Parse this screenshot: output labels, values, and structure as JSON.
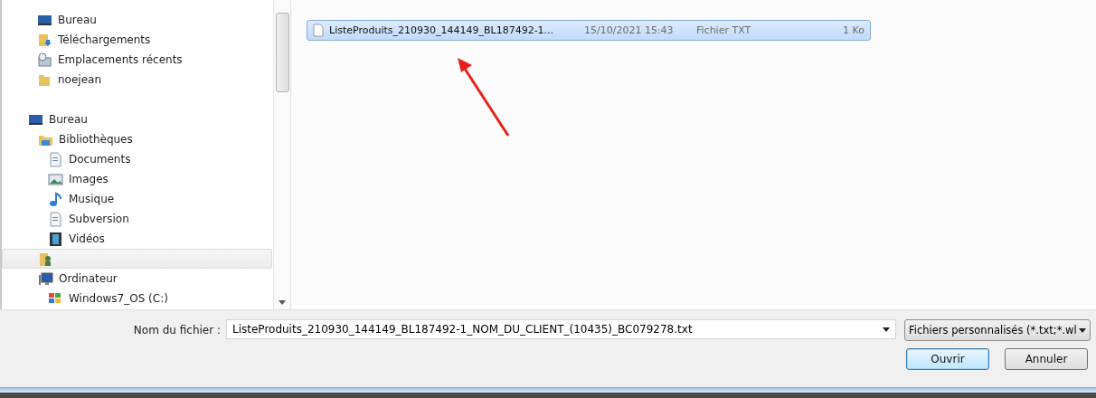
{
  "nav": {
    "favorites": [
      {
        "kind": "desktop",
        "label": "Bureau",
        "selected": false
      },
      {
        "kind": "download",
        "label": "Téléchargements",
        "selected": false
      },
      {
        "kind": "recent",
        "label": "Emplacements récents",
        "selected": false
      },
      {
        "kind": "folder",
        "label": "noejean",
        "selected": false
      }
    ],
    "tree": [
      {
        "kind": "desktop",
        "label": "Bureau",
        "selected": false,
        "children": [
          {
            "kind": "library",
            "label": "Bibliothèques",
            "selected": false,
            "children": [
              {
                "kind": "document",
                "label": "Documents",
                "selected": false
              },
              {
                "kind": "images",
                "label": "Images",
                "selected": false
              },
              {
                "kind": "music",
                "label": "Musique",
                "selected": false
              },
              {
                "kind": "document",
                "label": "Subversion",
                "selected": false
              },
              {
                "kind": "video",
                "label": "Vidéos",
                "selected": false
              }
            ]
          },
          {
            "kind": "user",
            "selected": true
          },
          {
            "kind": "computer",
            "label": "Ordinateur",
            "selected": false,
            "children": [
              {
                "kind": "drive",
                "label": "Windows7_OS (C:)",
                "selected": false
              }
            ]
          }
        ]
      }
    ]
  },
  "files": [
    {
      "name": "ListeProduits_210930_144149_BL187492-1...",
      "date": "15/10/2021 15:43",
      "type": "Fichier TXT",
      "size": "1 Ko",
      "selected": true
    }
  ],
  "filename": {
    "label": "Nom du fichier :",
    "value": "ListeProduits_210930_144149_BL187492-1_NOM_DU_CLIENT_(10435)_BC079278.txt"
  },
  "filter": {
    "value": "Fichiers personnalisés (*.txt;*.wl"
  },
  "buttons": [
    {
      "label": "Ouvrir",
      "default": true
    },
    {
      "label": "Annuler",
      "default": false
    }
  ]
}
